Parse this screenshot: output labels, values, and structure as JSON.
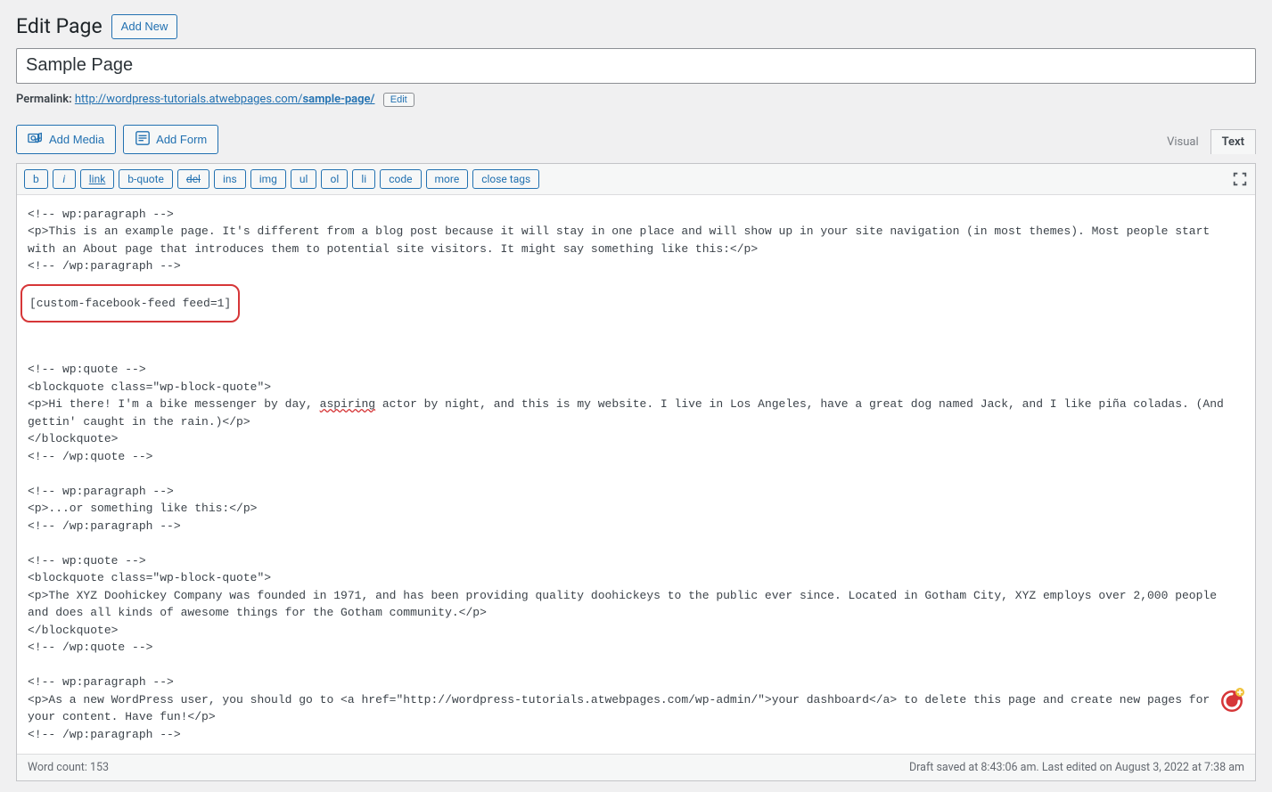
{
  "header": {
    "title": "Edit Page",
    "add_new": "Add New"
  },
  "title_input": "Sample Page",
  "permalink": {
    "label": "Permalink:",
    "base": "http://wordpress-tutorials.atwebpages.com/",
    "slug": "sample-page/",
    "edit": "Edit"
  },
  "media": {
    "add_media": "Add Media",
    "add_form": "Add Form"
  },
  "tabs": {
    "visual": "Visual",
    "text": "Text"
  },
  "quicktags": {
    "b": "b",
    "i": "i",
    "link": "link",
    "bquote": "b-quote",
    "del": "del",
    "ins": "ins",
    "img": "img",
    "ul": "ul",
    "ol": "ol",
    "li": "li",
    "code": "code",
    "more": "more",
    "close": "close tags"
  },
  "content": {
    "p1a": "<!-- wp:paragraph -->\n<p>This is an example page. It's different from a blog post because it will stay in one place and will show up in your site navigation (in most themes). Most people start with an About page that introduces them to potential site visitors. It might say something like this:</p>\n<!-- /wp:paragraph -->",
    "shortcode": "[custom-facebook-feed feed=1]",
    "q1_pre": "<!-- wp:quote -->\n<blockquote class=\"wp-block-quote\">\n<p>Hi there! I'm a bike messenger by day, ",
    "q1_err": "aspiring",
    "q1_post": " actor by night, and this is my website. I live in Los Angeles, have a great dog named Jack, and I like piña coladas. (And gettin' caught in the rain.)</p>\n</blockquote>\n<!-- /wp:quote -->",
    "p2": "<!-- wp:paragraph -->\n<p>...or something like this:</p>\n<!-- /wp:paragraph -->",
    "q2": "<!-- wp:quote -->\n<blockquote class=\"wp-block-quote\">\n<p>The XYZ Doohickey Company was founded in 1971, and has been providing quality doohickeys to the public ever since. Located in Gotham City, XYZ employs over 2,000 people and does all kinds of awesome things for the Gotham community.</p>\n</blockquote>\n<!-- /wp:quote -->",
    "p3": "<!-- wp:paragraph -->\n<p>As a new WordPress user, you should go to <a href=\"http://wordpress-tutorials.atwebpages.com/wp-admin/\">your dashboard</a> to delete this page and create new pages for your content. Have fun!</p>\n<!-- /wp:paragraph -->"
  },
  "status": {
    "word_count": "Word count: 153",
    "saved": "Draft saved at 8:43:06 am. Last edited on August 3, 2022 at 7:38 am"
  }
}
